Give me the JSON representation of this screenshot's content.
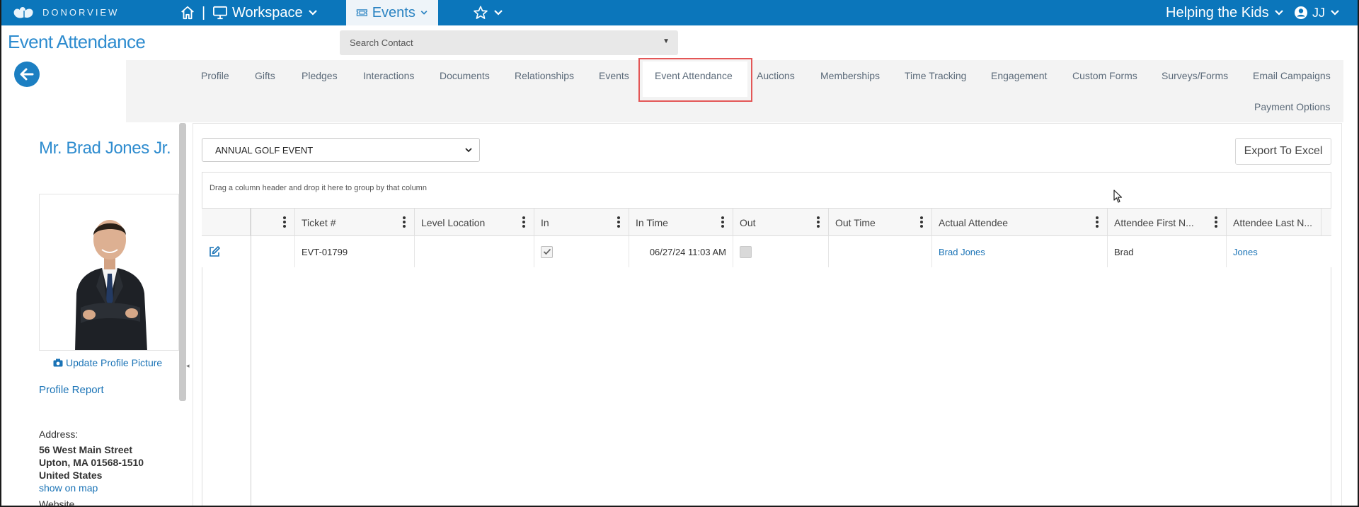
{
  "topbar": {
    "logo_text": "DONORVIEW",
    "workspace_label": "Workspace",
    "events_label": "Events",
    "org_label": "Helping the Kids",
    "user_initials": "JJ"
  },
  "page": {
    "title": "Event Attendance"
  },
  "search": {
    "placeholder": "Search Contact"
  },
  "tabs": {
    "row1": [
      "Profile",
      "Gifts",
      "Pledges",
      "Interactions",
      "Documents",
      "Relationships",
      "Events",
      "Event Attendance",
      "Auctions",
      "Memberships",
      "Time Tracking",
      "Engagement",
      "Custom Forms",
      "Surveys/Forms",
      "Email Campaigns"
    ],
    "row2": [
      "Payment Options"
    ],
    "active": "Event Attendance"
  },
  "profile": {
    "name": "Mr. Brad Jones Jr.",
    "update_picture": "Update Profile Picture",
    "profile_report": "Profile Report",
    "address_label": "Address:",
    "address_lines": [
      "56 West Main Street",
      "Upton, MA 01568-1510",
      "United States"
    ],
    "show_on_map": "show on map",
    "website_label": "Website"
  },
  "main": {
    "selected_event": "ANNUAL GOLF EVENT",
    "export_label": "Export To Excel",
    "group_hint": "Drag a column header and drop it here to group by that column"
  },
  "grid": {
    "columns": [
      "",
      "Ticket #",
      "Level Location",
      "In",
      "In Time",
      "Out",
      "Out Time",
      "Actual Attendee",
      "Attendee First N...",
      "Attendee Last N..."
    ],
    "rows": [
      {
        "ticket": "EVT-01799",
        "level_location": "",
        "in_checked": true,
        "in_time": "06/27/24 11:03 AM",
        "out_checked": false,
        "out_time": "",
        "actual_attendee": "Brad Jones",
        "first_name": "Brad",
        "last_name": "Jones"
      }
    ]
  },
  "colors": {
    "topbar": "#0b76bb",
    "accent": "#2e8ccf",
    "link": "#1a73b6",
    "highlight": "#e35656"
  }
}
